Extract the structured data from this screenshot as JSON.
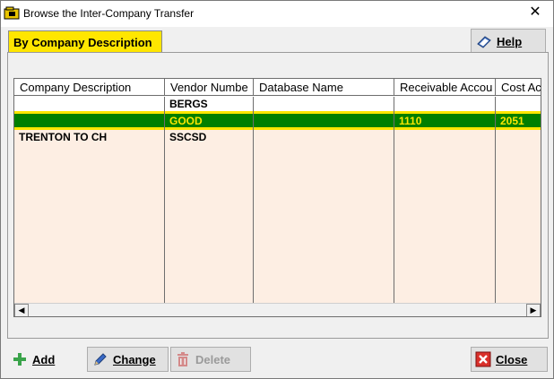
{
  "window": {
    "title": "Browse the Inter-Company Transfer"
  },
  "tab": {
    "label": "By Company Description"
  },
  "buttons": {
    "help": "Help",
    "add": "Add",
    "change": "Change",
    "delete": "Delete",
    "close": "Close"
  },
  "grid": {
    "columns": [
      "Company Description",
      "Vendor Numbe",
      "Database Name",
      "Receivable Accou",
      "Cost Ac"
    ],
    "rows": [
      [
        "",
        "BERGS",
        "",
        "",
        ""
      ],
      [
        "",
        "GOOD",
        "",
        "1110",
        "2051"
      ],
      [
        "TRENTON TO CH",
        "SSCSD",
        "",
        "",
        ""
      ]
    ],
    "selected_row_index": 1
  },
  "icons": {
    "title": "folder-icon",
    "help": "help-book-icon",
    "add": "plus-icon",
    "change": "pencil-icon",
    "delete": "trash-icon",
    "close": "close-x-icon"
  },
  "colors": {
    "tab_accent": "#ffe600",
    "selected_row_bg": "#007f00",
    "selected_row_text": "#ffe600",
    "grid_body_bg": "#fdeee3"
  }
}
